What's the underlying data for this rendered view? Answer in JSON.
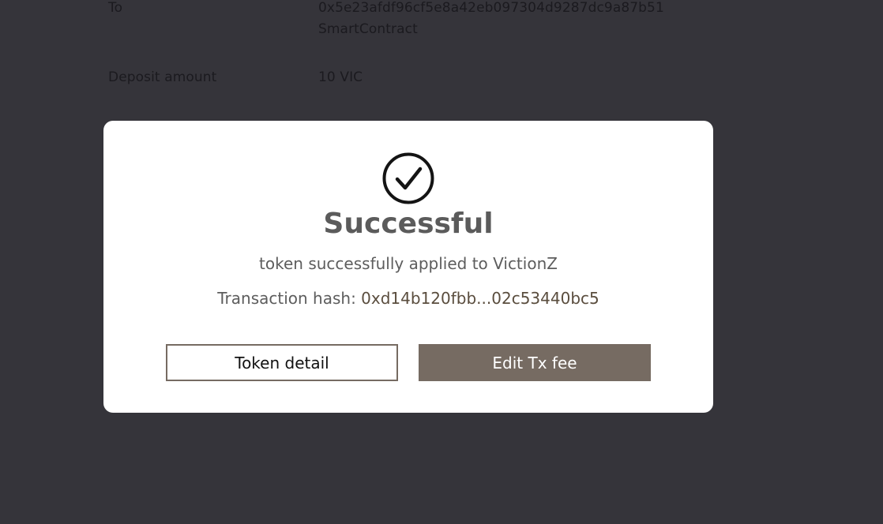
{
  "background": {
    "to_label": "To",
    "to_address": "0x5e23afdf96cf5e8a42eb097304d9287dc9a87b51",
    "to_type": "SmartContract",
    "deposit_label": "Deposit amount",
    "deposit_value": "10 VIC"
  },
  "modal": {
    "icon": "check-circle-icon",
    "title": "Successful",
    "message": "token successfully applied to VictionZ",
    "hash_label": "Transaction hash:",
    "hash_value": "0xd14b120fbb...02c53440bc5",
    "buttons": {
      "token_detail": "Token detail",
      "edit_tx_fee": "Edit Tx fee"
    }
  },
  "colors": {
    "overlay": "#35343a",
    "modal_bg": "#ffffff",
    "accent": "#766b62"
  }
}
